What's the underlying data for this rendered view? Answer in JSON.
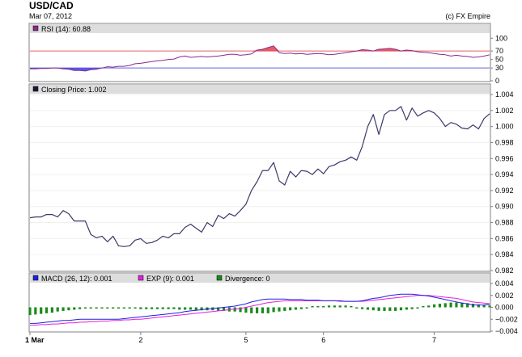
{
  "header": {
    "title": "USD/CAD",
    "date": "Mar 07, 2012",
    "credit": "(c) FX Empire"
  },
  "colors": {
    "price_line": "#3a3a6a",
    "rsi_line": "#8b2a8b",
    "rsi_fill_over": "#e04050",
    "rsi_fill_under": "#4040e0",
    "macd_line": "#2020e0",
    "exp_line": "#e020e0",
    "divergence": "#1a8a1a",
    "level_70": "#e06060",
    "level_30": "#6060e0"
  },
  "chart_data": [
    {
      "type": "line",
      "panel": "rsi",
      "legend": "RSI (14): 60.88",
      "levels": [
        70,
        30
      ],
      "ylim": [
        0,
        110
      ],
      "yticks": [
        0,
        30,
        50,
        70,
        100
      ],
      "series": [
        {
          "name": "RSI (14)",
          "values": [
            28,
            28,
            29,
            29,
            30,
            30,
            28,
            27,
            24,
            24,
            23,
            26,
            27,
            30,
            33,
            32,
            34,
            34,
            36,
            40,
            41,
            43,
            45,
            47,
            48,
            50,
            51,
            56,
            58,
            55,
            56,
            57,
            56,
            57,
            58,
            60,
            62,
            62,
            60,
            61,
            63,
            72,
            74,
            78,
            82,
            66,
            64,
            65,
            63,
            64,
            62,
            63,
            64,
            63,
            61,
            62,
            64,
            66,
            68,
            70,
            73,
            72,
            70,
            74,
            75,
            76,
            74,
            70,
            72,
            71,
            68,
            67,
            66,
            64,
            62,
            61,
            58,
            60,
            58,
            57,
            55,
            56,
            58,
            61
          ]
        }
      ]
    },
    {
      "type": "line",
      "panel": "price",
      "legend": "Closing Price: 1.002",
      "ylim": [
        0.982,
        1.004
      ],
      "yticks": [
        0.982,
        0.984,
        0.986,
        0.988,
        0.99,
        0.992,
        0.994,
        0.996,
        0.998,
        1.0,
        1.002,
        1.004
      ],
      "ytick_labels": [
        "0.982",
        "0.984",
        "0.986",
        "0.988",
        "0.990",
        "0.992",
        "0.994",
        "0.996",
        "0.998",
        "1.000",
        "1.002",
        "1.004"
      ],
      "x_labels": [
        {
          "label": "1 Mar",
          "index": 0
        },
        {
          "label": "2",
          "index": 20
        },
        {
          "label": "5",
          "index": 39
        },
        {
          "label": "6",
          "index": 53
        },
        {
          "label": "7",
          "index": 73
        }
      ],
      "series": [
        {
          "name": "Closing Price",
          "values": [
            0.9886,
            0.9887,
            0.9887,
            0.989,
            0.989,
            0.9887,
            0.9895,
            0.9891,
            0.9882,
            0.9882,
            0.9882,
            0.9865,
            0.9861,
            0.9863,
            0.9856,
            0.9863,
            0.9851,
            0.985,
            0.9851,
            0.9858,
            0.986,
            0.9854,
            0.9855,
            0.9858,
            0.9863,
            0.9861,
            0.9866,
            0.9866,
            0.9874,
            0.9878,
            0.9873,
            0.9868,
            0.988,
            0.9875,
            0.9889,
            0.9885,
            0.9891,
            0.9888,
            0.9895,
            0.9903,
            0.992,
            0.9931,
            0.9945,
            0.9945,
            0.9955,
            0.9932,
            0.9927,
            0.9944,
            0.9937,
            0.9945,
            0.9944,
            0.994,
            0.9947,
            0.9941,
            0.995,
            0.9952,
            0.9956,
            0.9958,
            0.9962,
            0.9958,
            0.9975,
            1.0,
            1.0015,
            0.999,
            1.0015,
            1.002,
            1.002,
            1.0025,
            1.0008,
            1.0023,
            1.0013,
            1.0017,
            1.002,
            1.0017,
            1.001,
            1.0,
            1.0005,
            1.0003,
            0.9998,
            0.9997,
            1.0002,
            0.9997,
            1.001,
            1.0016
          ]
        }
      ]
    },
    {
      "type": "line",
      "panel": "macd",
      "legend": [
        {
          "label": "MACD (26, 12): 0.001",
          "color": "#2020e0"
        },
        {
          "label": "EXP (9): 0.001",
          "color": "#e020e0"
        },
        {
          "label": "Divergence: 0",
          "color": "#1a8a1a"
        }
      ],
      "ylim": [
        -0.004,
        0.004
      ],
      "yticks": [
        -0.004,
        -0.002,
        0.0,
        0.002,
        0.004
      ],
      "ytick_labels": [
        "−0.004",
        "−0.002",
        "0.000",
        "0.002",
        "0.004"
      ],
      "series": [
        {
          "name": "MACD (26, 12)",
          "values": [
            -0.0027,
            -0.0027,
            -0.0026,
            -0.0025,
            -0.0024,
            -0.0023,
            -0.0022,
            -0.0022,
            -0.0021,
            -0.002,
            -0.002,
            -0.002,
            -0.002,
            -0.002,
            -0.002,
            -0.002,
            -0.002,
            -0.0019,
            -0.0018,
            -0.0017,
            -0.0016,
            -0.0015,
            -0.0014,
            -0.0013,
            -0.0012,
            -0.0011,
            -0.001,
            -0.0009,
            -0.0007,
            -0.0006,
            -0.0005,
            -0.0004,
            -0.0003,
            -0.0002,
            -0.0001,
            0.0,
            0.0001,
            0.0002,
            0.0004,
            0.0006,
            0.0009,
            0.0011,
            0.0013,
            0.0014,
            0.0014,
            0.0014,
            0.0014,
            0.0013,
            0.0013,
            0.0013,
            0.0012,
            0.0012,
            0.0012,
            0.0011,
            0.0011,
            0.0011,
            0.0011,
            0.001,
            0.001,
            0.001,
            0.0011,
            0.0013,
            0.0015,
            0.0016,
            0.0018,
            0.002,
            0.0021,
            0.0022,
            0.0022,
            0.0022,
            0.0021,
            0.002,
            0.0019,
            0.0017,
            0.0015,
            0.0013,
            0.0011,
            0.0009,
            0.0007,
            0.0006,
            0.0004,
            0.0004,
            0.0004,
            0.0005
          ]
        },
        {
          "name": "EXP (9)",
          "values": [
            -0.003,
            -0.003,
            -0.0029,
            -0.0029,
            -0.0028,
            -0.0028,
            -0.0027,
            -0.0026,
            -0.0026,
            -0.0025,
            -0.0025,
            -0.0024,
            -0.0024,
            -0.0023,
            -0.0023,
            -0.0022,
            -0.0022,
            -0.0021,
            -0.0021,
            -0.002,
            -0.002,
            -0.0019,
            -0.0018,
            -0.0017,
            -0.0016,
            -0.0015,
            -0.0014,
            -0.0013,
            -0.0012,
            -0.0011,
            -0.001,
            -0.0009,
            -0.0008,
            -0.0007,
            -0.0006,
            -0.0005,
            -0.0004,
            -0.0003,
            -0.0002,
            0.0,
            0.0002,
            0.0004,
            0.0006,
            0.0008,
            0.0009,
            0.001,
            0.0011,
            0.0011,
            0.0011,
            0.0011,
            0.0011,
            0.0011,
            0.0011,
            0.0011,
            0.0011,
            0.0011,
            0.001,
            0.001,
            0.001,
            0.001,
            0.001,
            0.0011,
            0.0012,
            0.0013,
            0.0014,
            0.0015,
            0.0016,
            0.0017,
            0.0018,
            0.0019,
            0.002,
            0.002,
            0.002,
            0.0019,
            0.0018,
            0.0017,
            0.0016,
            0.0015,
            0.0013,
            0.0011,
            0.0009,
            0.0008,
            0.0007,
            0.0006
          ]
        },
        {
          "name": "Divergence",
          "type": "bar",
          "values": [
            -0.0013,
            -0.0012,
            -0.0011,
            -0.001,
            -0.0009,
            -0.0007,
            -0.0006,
            -0.0005,
            -0.0004,
            -0.0003,
            -0.0002,
            -0.0002,
            -0.0002,
            -0.0002,
            -0.0002,
            -0.0001,
            -0.0001,
            -0.0002,
            -0.0002,
            -0.0002,
            -0.0003,
            -0.0003,
            -0.0003,
            -0.0003,
            -0.0003,
            -0.0003,
            -0.0003,
            -0.0004,
            -0.0004,
            -0.0004,
            -0.0005,
            -0.0005,
            -0.0005,
            -0.0005,
            -0.0006,
            -0.0006,
            -0.0007,
            -0.0007,
            -0.0008,
            -0.0009,
            -0.001,
            -0.001,
            -0.001,
            -0.001,
            -0.0008,
            -0.0007,
            -0.0006,
            -0.0005,
            -0.0004,
            -0.0003,
            -0.0002,
            0.0001,
            0.0002,
            0.0002,
            0.0003,
            0.0003,
            0.0003,
            0.0003,
            0.0002,
            -0.0002,
            -0.0003,
            -0.0004,
            -0.0005,
            -0.0006,
            -0.0006,
            -0.0006,
            -0.0006,
            -0.0005,
            -0.0004,
            -0.0003,
            -0.0001,
            0.0002,
            0.0003,
            0.0005,
            0.0006,
            0.0007,
            0.0008,
            0.0008,
            0.0008,
            0.0007,
            0.0006,
            0.0005,
            0.0004,
            0.0003
          ]
        }
      ]
    }
  ]
}
